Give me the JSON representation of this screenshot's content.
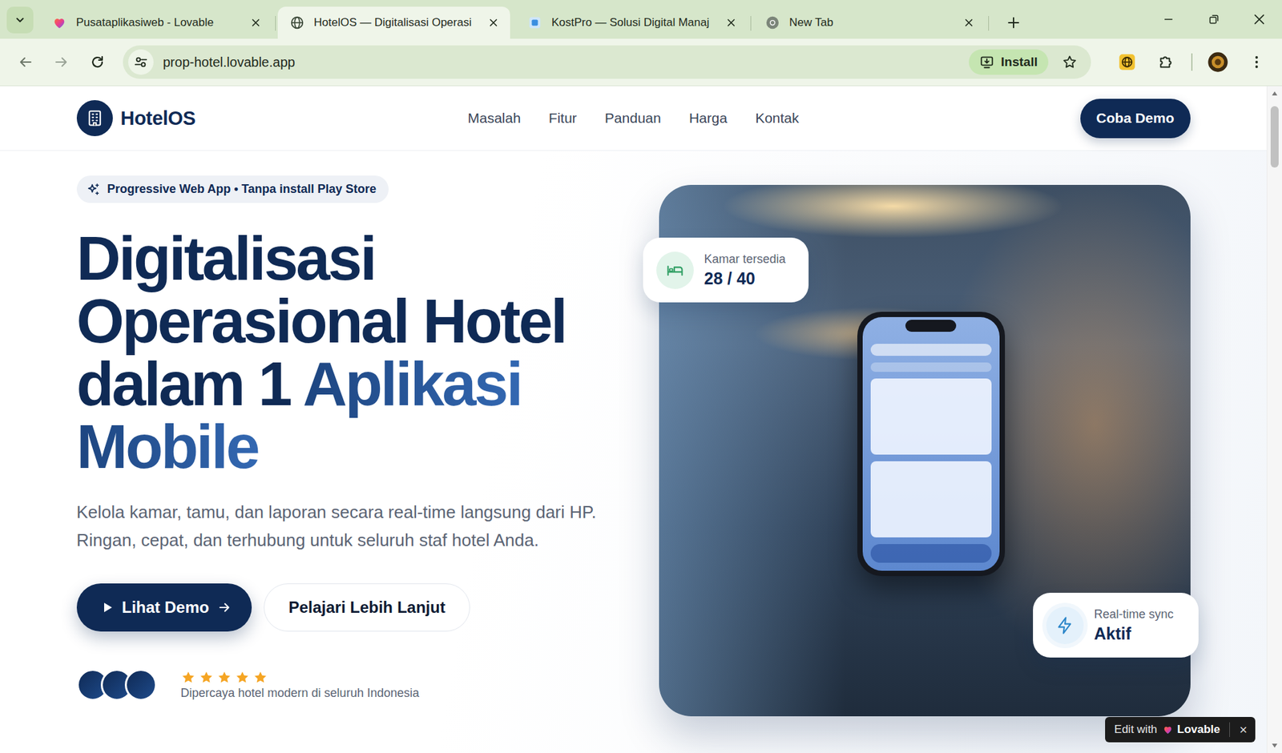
{
  "browser": {
    "tabs": [
      {
        "label": "Pusataplikasiweb - Lovable",
        "selected": false,
        "kind": "lovable"
      },
      {
        "label": "HotelOS — Digitalisasi Operasi",
        "selected": true,
        "kind": "globe"
      },
      {
        "label": "KostPro — Solusi Digital Manaj",
        "selected": false,
        "kind": "kostpro"
      },
      {
        "label": "New Tab",
        "selected": false,
        "kind": "chrome"
      }
    ],
    "url": "prop-hotel.lovable.app",
    "install_label": "Install"
  },
  "nav": {
    "brand": "HotelOS",
    "links": [
      "Masalah",
      "Fitur",
      "Panduan",
      "Harga",
      "Kontak"
    ],
    "cta": "Coba Demo"
  },
  "hero": {
    "badge": "Progressive Web App • Tanpa install Play Store",
    "title_lines": [
      [
        {
          "text": "Digitalisasi",
          "accent": false
        }
      ],
      [
        {
          "text": "Operasional Hotel",
          "accent": false
        }
      ],
      [
        {
          "text": "dalam 1 ",
          "accent": false
        },
        {
          "text": "Aplikasi",
          "accent": true
        }
      ],
      [
        {
          "text": "Mobile",
          "accent": true
        }
      ]
    ],
    "description": "Kelola kamar, tamu, dan laporan secara real-time langsung dari HP. Ringan, cepat, dan terhubung untuk seluruh staf hotel Anda.",
    "primary_button": "Lihat Demo",
    "secondary_button": "Pelajari Lebih Lanjut",
    "trust": {
      "avatars": 3,
      "stars": 5,
      "text": "Dipercaya hotel modern di seluruh Indonesia"
    }
  },
  "stat_cards": [
    {
      "label": "Kamar tersedia",
      "value": "28 / 40",
      "kind": "rooms"
    },
    {
      "label": "Real-time sync",
      "value": "Aktif",
      "kind": "sync"
    }
  ],
  "lovable_badge": {
    "label": "Edit with",
    "brand": "Lovable",
    "close": "×"
  }
}
